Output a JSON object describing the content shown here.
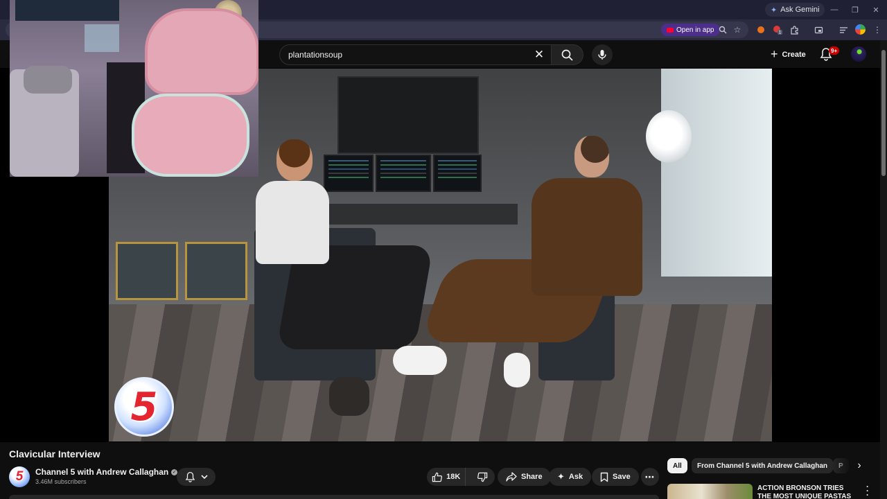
{
  "browser": {
    "gemini_label": "Ask Gemini",
    "open_in_app_label": "Open in app",
    "notification_count": "1"
  },
  "header": {
    "search": {
      "value": "plantationsoup"
    },
    "create_label": "Create",
    "notification_badge": "9+"
  },
  "video": {
    "title": "Clavicular Interview",
    "channel": {
      "name": "Channel 5 with Andrew Callaghan",
      "subscribers": "3.46M subscribers",
      "logo_glyph": "5"
    },
    "actions": {
      "like_count": "18K",
      "share_label": "Share",
      "ask_label": "Ask",
      "save_label": "Save"
    }
  },
  "sidebar": {
    "chips": [
      "All",
      "From Channel 5 with Andrew Callaghan",
      "P"
    ],
    "recommendations": [
      {
        "title": "ACTION BRONSON TRIES THE MOST UNIQUE PASTAS"
      }
    ]
  },
  "icons": {
    "search": "search-icon",
    "mic": "mic-icon",
    "bell": "bell-icon",
    "like": "thumbs-up-icon",
    "dislike": "thumbs-down-icon",
    "share": "share-arrow-icon",
    "ask": "sparkle-icon",
    "save": "bookmark-icon"
  },
  "colors": {
    "background": "#0f0f0f",
    "pill": "#272727",
    "accent_red": "#ff0033",
    "open_in_app": "#4b2f8a"
  }
}
